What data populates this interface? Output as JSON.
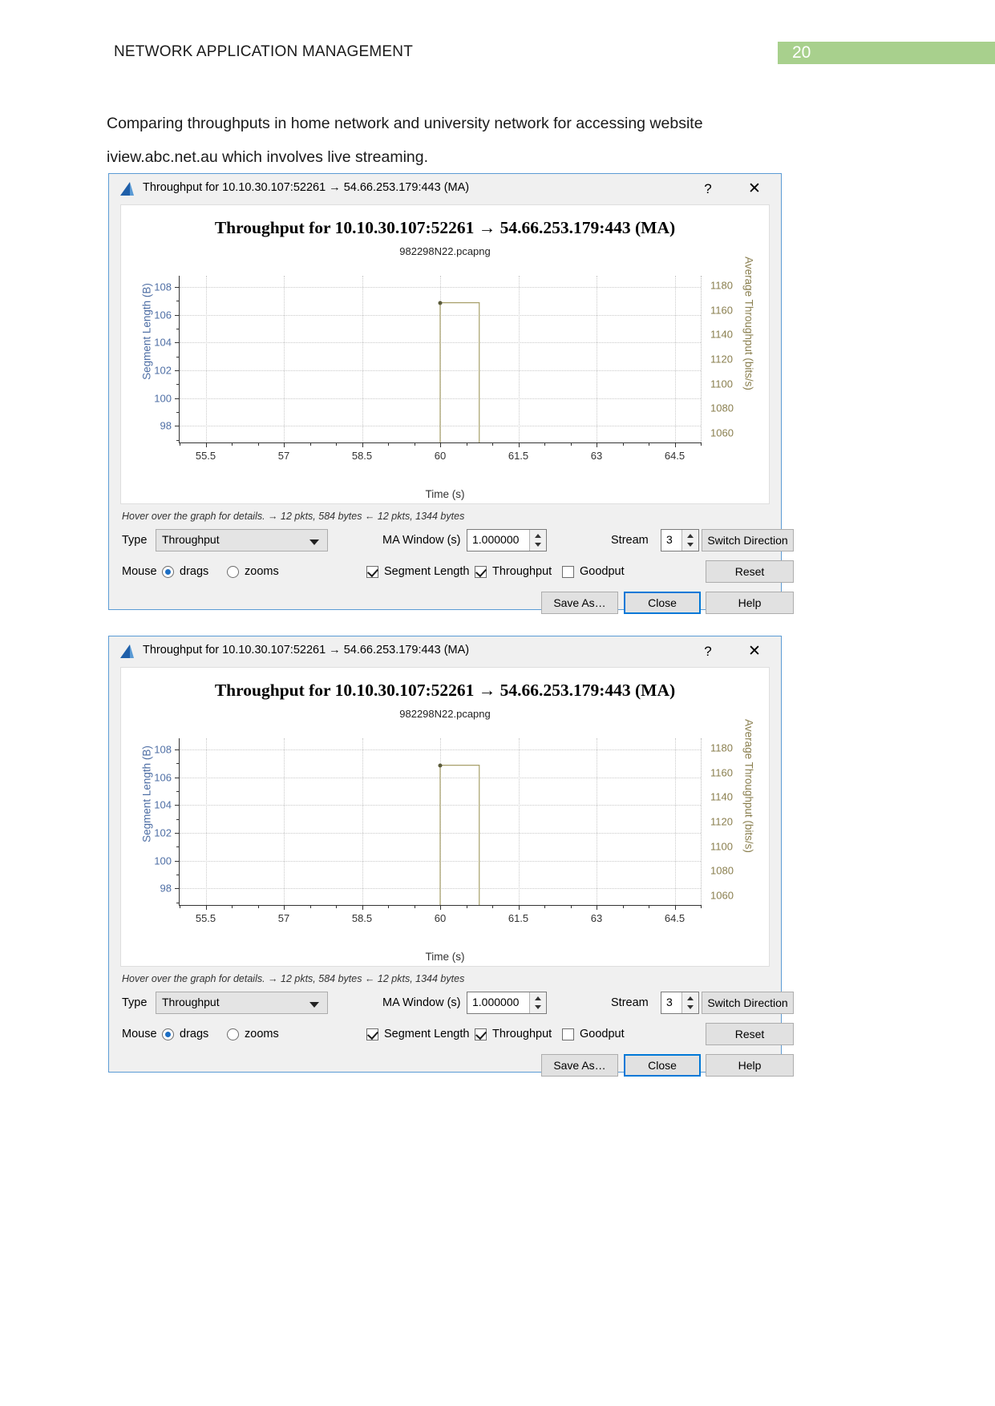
{
  "document": {
    "header_title": "NETWORK APPLICATION MANAGEMENT",
    "page_number": "20",
    "page_badge_color": "#a8d08d",
    "paragraph": "Comparing throughputs in home network and university network for accessing website iview.abc.net.au which involves live streaming."
  },
  "dialog": {
    "titlebar": {
      "icon": "wireshark-shark-fin-icon",
      "title": "Throughput for 10.10.30.107:52261 → 54.66.253.179:443 (MA)",
      "help_label": "?",
      "close_label": "✕"
    },
    "hint": "Hover over the graph for details. → 12 pkts, 584 bytes ← 12 pkts, 1344 bytes",
    "controls": {
      "type_label": "Type",
      "type_value": "Throughput",
      "ma_window_label": "MA Window (s)",
      "ma_window_value": "1.000000",
      "stream_label": "Stream",
      "stream_value": "3",
      "switch_direction_label": "Switch Direction",
      "mouse_label": "Mouse",
      "mouse_drags_label": "drags",
      "mouse_zooms_label": "zooms",
      "mouse_selected": "drags",
      "checkbox_segment_length_label": "Segment Length",
      "checkbox_segment_length_checked": true,
      "checkbox_throughput_label": "Throughput",
      "checkbox_throughput_checked": true,
      "checkbox_goodput_label": "Goodput",
      "checkbox_goodput_checked": false,
      "reset_label": "Reset",
      "save_as_label": "Save As…",
      "close_label": "Close",
      "help_label": "Help"
    }
  },
  "chart_data": {
    "type": "line",
    "title": "Throughput for 10.10.30.107:52261 → 54.66.253.179:443 (MA)",
    "subtitle": "982298N22.pcapng",
    "xlabel": "Time (s)",
    "ylabel": "Segment Length (B)",
    "y2label": "Average Throughput (bits/s)",
    "xlim": [
      55.0,
      65.0
    ],
    "xticks": [
      "55.5",
      "57",
      "58.5",
      "60",
      "61.5",
      "63",
      "64.5"
    ],
    "xtick_values": [
      55.5,
      57,
      58.5,
      60,
      61.5,
      63,
      64.5
    ],
    "ylim": [
      96.8,
      108.8
    ],
    "yticks": [
      "98",
      "100",
      "102",
      "104",
      "106",
      "108"
    ],
    "ytick_values": [
      98,
      100,
      102,
      104,
      106,
      108
    ],
    "y2lim": [
      1052,
      1188
    ],
    "y2ticks": [
      "1060",
      "1080",
      "1100",
      "1120",
      "1140",
      "1160",
      "1180"
    ],
    "y2tick_values": [
      1060,
      1080,
      1100,
      1120,
      1140,
      1160,
      1180
    ],
    "grid": true,
    "legend": "none",
    "series": [
      {
        "name": "Average Throughput (bits/s)",
        "color": "#a8a06a",
        "axis": "right",
        "points": [
          {
            "x": 60.0,
            "y": 1052
          },
          {
            "x": 60.0,
            "y": 1166
          },
          {
            "x": 60.75,
            "y": 1166
          },
          {
            "x": 60.75,
            "y": 1052
          }
        ],
        "marker_points": [
          {
            "x": 60.0,
            "y": 1166
          }
        ]
      }
    ]
  }
}
